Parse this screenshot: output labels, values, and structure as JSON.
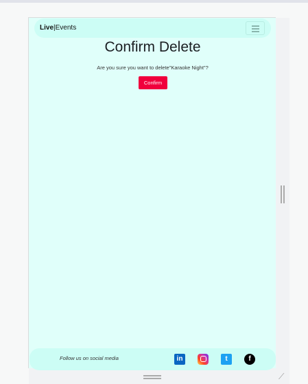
{
  "nav": {
    "brand_bold": "Live",
    "brand_sep": "|",
    "brand_rest": "Events"
  },
  "main": {
    "title": "Confirm Delete",
    "message": "Are you sure you want to delete\"Karaoke Night\"?",
    "confirm_label": "Confirm"
  },
  "footer": {
    "follow_text": "Follow us on social media",
    "icons": [
      "linkedin-icon",
      "instagram-icon",
      "twitter-icon",
      "facebook-icon"
    ],
    "colors": {
      "linkedin": "#0a66c2",
      "twitter": "#1da1f2",
      "facebook": "#000000"
    }
  }
}
